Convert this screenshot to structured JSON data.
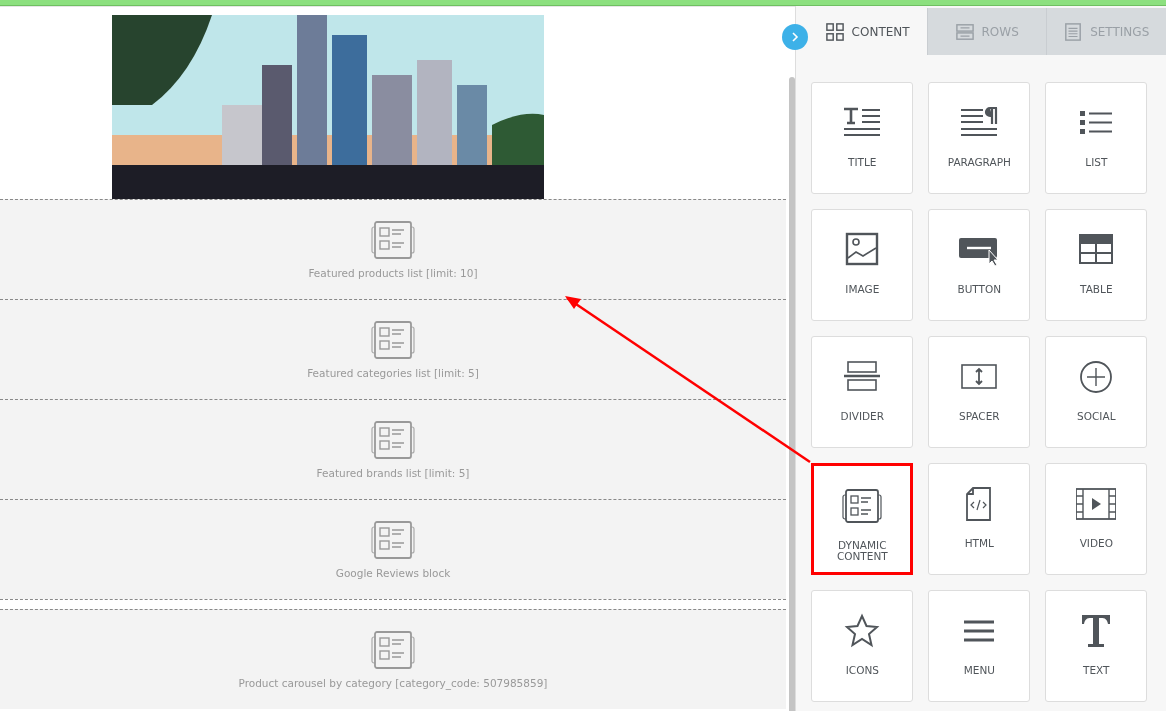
{
  "top_bar": {
    "level": 1
  },
  "canvas": {
    "blocks": [
      {
        "label": "Featured products list [limit: 10]",
        "gap_before": false
      },
      {
        "label": "Featured categories list [limit: 5]",
        "gap_before": false
      },
      {
        "label": "Featured brands list [limit: 5]",
        "gap_before": false
      },
      {
        "label": "Google Reviews block",
        "gap_before": false
      },
      {
        "label": "Product carousel by category [category_code: 507985859]",
        "gap_before": true
      }
    ]
  },
  "panel": {
    "tabs": [
      {
        "label": "CONTENT",
        "selected": true
      },
      {
        "label": "ROWS",
        "selected": false
      },
      {
        "label": "SETTINGS",
        "selected": false
      }
    ],
    "tiles": [
      {
        "label": "TITLE",
        "highlighted": false
      },
      {
        "label": "PARAGRAPH",
        "highlighted": false
      },
      {
        "label": "LIST",
        "highlighted": false
      },
      {
        "label": "IMAGE",
        "highlighted": false
      },
      {
        "label": "BUTTON",
        "highlighted": false
      },
      {
        "label": "TABLE",
        "highlighted": false
      },
      {
        "label": "DIVIDER",
        "highlighted": false
      },
      {
        "label": "SPACER",
        "highlighted": false
      },
      {
        "label": "SOCIAL",
        "highlighted": false
      },
      {
        "label": "DYNAMIC CONTENT",
        "highlighted": true
      },
      {
        "label": "HTML",
        "highlighted": false
      },
      {
        "label": "VIDEO",
        "highlighted": false
      },
      {
        "label": "ICONS",
        "highlighted": false
      },
      {
        "label": "MENU",
        "highlighted": false
      },
      {
        "label": "TEXT",
        "highlighted": false
      }
    ]
  }
}
